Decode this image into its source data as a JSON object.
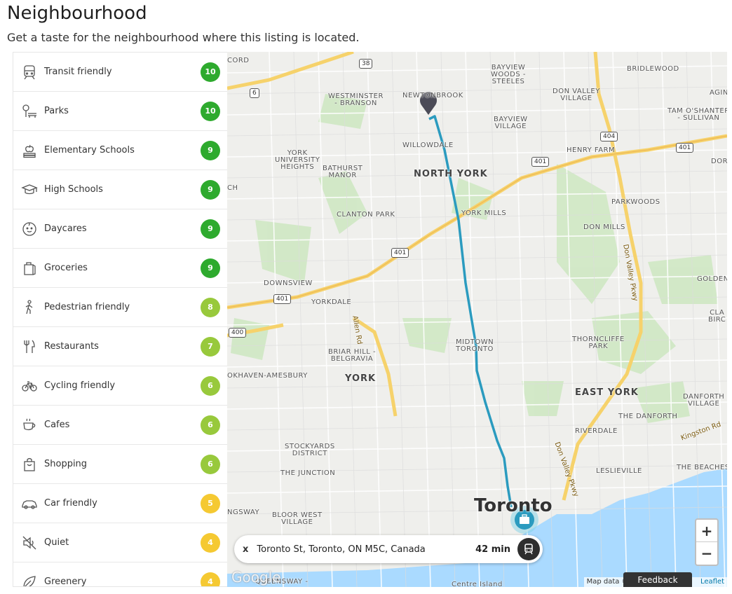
{
  "header": {
    "title": "Neighbourhood",
    "subtitle": "Get a taste for the neighbourhood where this listing is located."
  },
  "colors": {
    "score_dark_green": "#2eaa2e",
    "score_light_green": "#98c93c",
    "score_yellow": "#f5c932",
    "route": "#2b9bbf",
    "highway": "#f6d26b",
    "water": "#aadaff",
    "park": "#cfe8c4"
  },
  "categories": [
    {
      "label": "Transit friendly",
      "score": "10",
      "icon": "train-icon",
      "color": "#2eaa2e"
    },
    {
      "label": "Parks",
      "score": "10",
      "icon": "park-bench-icon",
      "color": "#2eaa2e"
    },
    {
      "label": "Elementary Schools",
      "score": "9",
      "icon": "apple-books-icon",
      "color": "#2eaa2e"
    },
    {
      "label": "High Schools",
      "score": "9",
      "icon": "graduation-cap-icon",
      "color": "#2eaa2e"
    },
    {
      "label": "Daycares",
      "score": "9",
      "icon": "baby-face-icon",
      "color": "#2eaa2e"
    },
    {
      "label": "Groceries",
      "score": "9",
      "icon": "grocery-bag-icon",
      "color": "#2eaa2e"
    },
    {
      "label": "Pedestrian friendly",
      "score": "8",
      "icon": "walking-person-icon",
      "color": "#98c93c"
    },
    {
      "label": "Restaurants",
      "score": "7",
      "icon": "fork-knife-icon",
      "color": "#98c93c"
    },
    {
      "label": "Cycling friendly",
      "score": "6",
      "icon": "bicycle-icon",
      "color": "#98c93c"
    },
    {
      "label": "Cafes",
      "score": "6",
      "icon": "coffee-cup-icon",
      "color": "#98c93c"
    },
    {
      "label": "Shopping",
      "score": "6",
      "icon": "shopping-bag-icon",
      "color": "#98c93c"
    },
    {
      "label": "Car friendly",
      "score": "5",
      "icon": "car-icon",
      "color": "#f5c932"
    },
    {
      "label": "Quiet",
      "score": "4",
      "icon": "muted-speaker-icon",
      "color": "#f5c932"
    },
    {
      "label": "Greenery",
      "score": "4",
      "icon": "leaf-icon",
      "color": "#f5c932"
    }
  ],
  "map": {
    "labels": {
      "cord": "CORD",
      "westminster": "WESTMINSTER\n- BRANSON",
      "newtonbrook": "NEWTONBROOK",
      "bayview_woods": "BAYVIEW\nWOODS -\nSTEELES",
      "bridlewood": "BRIDLEWOOD",
      "don_valley_village": "DON VALLEY\nVILLAGE",
      "agin": "AGIN",
      "tam": "TAM O'SHANTER\n- SULLIVAN",
      "bayview_village": "BAYVIEW\nVILLAGE",
      "willowdale": "WILLOWDALE",
      "henry_farm": "HENRY FARM",
      "york_u": "YORK\nUNIVERSITY\nHEIGHTS",
      "bathurst_manor": "BATHURST\nMANOR",
      "north_york": "NORTH YORK",
      "dor": "DOR",
      "ch": "CH",
      "clanton_park": "CLANTON PARK",
      "york_mills": "YORK MILLS",
      "parkwoods": "PARKWOODS",
      "don_mills": "DON MILLS",
      "downsview": "DOWNSVIEW",
      "yorkdale": "YORKDALE",
      "golden": "GOLDEN",
      "clair_birc": "CLA\nBIRC",
      "thorncliffe": "THORNCLIFFE\nPARK",
      "midtown": "MIDTOWN\nTORONTO",
      "briar_hill": "BRIAR HILL -\nBELGRAVIA",
      "okhaven": "OKHAVEN-AMESBURY",
      "york": "YORK",
      "east_york": "EAST YORK",
      "danforth_village": "DANFORTH\nVILLAGE",
      "the_danforth": "THE DANFORTH",
      "riverdale": "RIVERDALE",
      "stockyards": "STOCKYARDS\nDISTRICT",
      "the_junction": "THE JUNCTION",
      "leslieville": "LESLIEVILLE",
      "the_beaches": "THE BEACHES",
      "ngsway": "NGSWAY",
      "bloor_west": "BLOOR WEST\nVILLAGE",
      "toronto": "Toronto",
      "queensway": "QUEENSWAY -",
      "centre_island": "Centre Island"
    },
    "roads": {
      "allen_rd": "Allen Rd",
      "don_valley_pkwy_1": "Don Valley Pkwy",
      "don_valley_pkwy_2": "Don Valley Pkwy",
      "kingston_rd": "Kingston Rd"
    },
    "shields": [
      "38",
      "6",
      "404",
      "401",
      "401",
      "401",
      "401",
      "400"
    ],
    "zoom_in": "+",
    "zoom_out": "−",
    "destination": {
      "close": "x",
      "address": "Toronto St, Toronto, ON M5C, Canada",
      "time": "42 min",
      "mode_icon": "transit-icon"
    },
    "attribution_prefix": "Map data ©",
    "attribution_leaflet": "Leaflet",
    "google_logo": "Google",
    "feedback": "Feedback"
  }
}
